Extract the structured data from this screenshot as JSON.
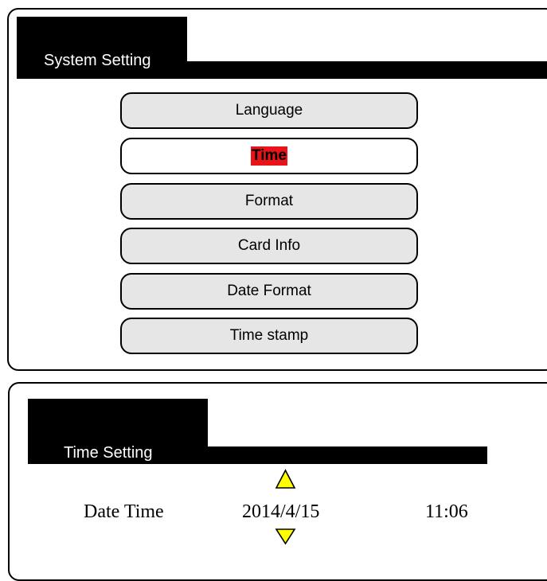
{
  "system_setting": {
    "title": "System Setting",
    "menu_items": [
      {
        "label": "Language",
        "selected": false
      },
      {
        "label": "Time",
        "selected": true
      },
      {
        "label": "Format",
        "selected": false
      },
      {
        "label": "Card Info",
        "selected": false
      },
      {
        "label": "Date Format",
        "selected": false
      },
      {
        "label": "Time stamp",
        "selected": false
      }
    ],
    "highlight_color": "#e8141a"
  },
  "time_setting": {
    "title": "Time Setting",
    "label": "Date Time",
    "date": "2014/4/15",
    "time": "11:06",
    "arrow_color": "#ffff00",
    "icons": [
      "arrow-up-icon",
      "arrow-down-icon"
    ]
  }
}
